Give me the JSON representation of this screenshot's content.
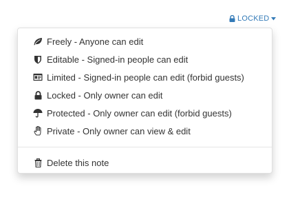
{
  "toggle": {
    "label": "LOCKED",
    "icon": "lock-icon",
    "caret_icon": "caret-down-icon",
    "color": "#337ab7"
  },
  "menu": {
    "permissions": [
      {
        "icon": "leaf-icon",
        "label": "Freely - Anyone can edit"
      },
      {
        "icon": "shield-icon",
        "label": "Editable - Signed-in people can edit"
      },
      {
        "icon": "id-card-icon",
        "label": "Limited - Signed-in people can edit (forbid guests)"
      },
      {
        "icon": "lock-icon",
        "label": "Locked - Only owner can edit"
      },
      {
        "icon": "umbrella-icon",
        "label": "Protected - Only owner can edit (forbid guests)"
      },
      {
        "icon": "hand-icon",
        "label": "Private - Only owner can view & edit"
      }
    ],
    "delete": {
      "icon": "trash-icon",
      "label": "Delete this note"
    }
  }
}
